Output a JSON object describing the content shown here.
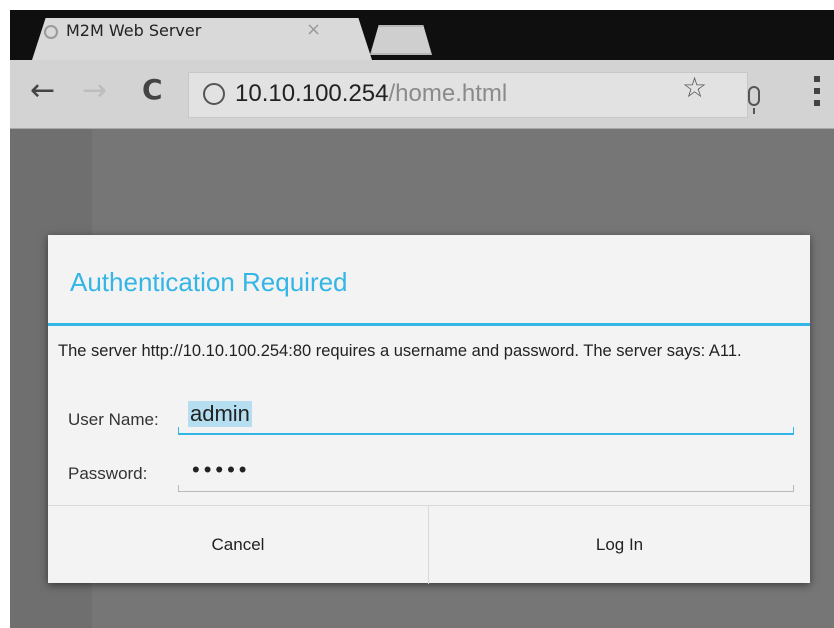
{
  "browser": {
    "tab": {
      "title": "M2M Web Server",
      "close_glyph": "×"
    },
    "url": {
      "host": "10.10.100.254",
      "path": "/home.html"
    },
    "icons": {
      "back": "arrow-left-icon",
      "forward": "arrow-right-icon",
      "reload": "reload-icon",
      "site_info": "globe-icon",
      "bookmark": "star-icon",
      "voice": "microphone-icon",
      "menu": "overflow-menu-icon"
    }
  },
  "dialog": {
    "title": "Authentication Required",
    "message": "The server http://10.10.100.254:80 requires a username and password. The server says: A11.",
    "username_label": "User Name:",
    "username_value": "admin",
    "password_label": "Password:",
    "password_value": "•••••",
    "cancel_label": "Cancel",
    "login_label": "Log In"
  },
  "colors": {
    "accent": "#33b5e5",
    "dialog_bg": "#f3f3f3",
    "toolbar_bg": "#d3d3d3",
    "tabstrip_bg": "#0f0f0f"
  }
}
